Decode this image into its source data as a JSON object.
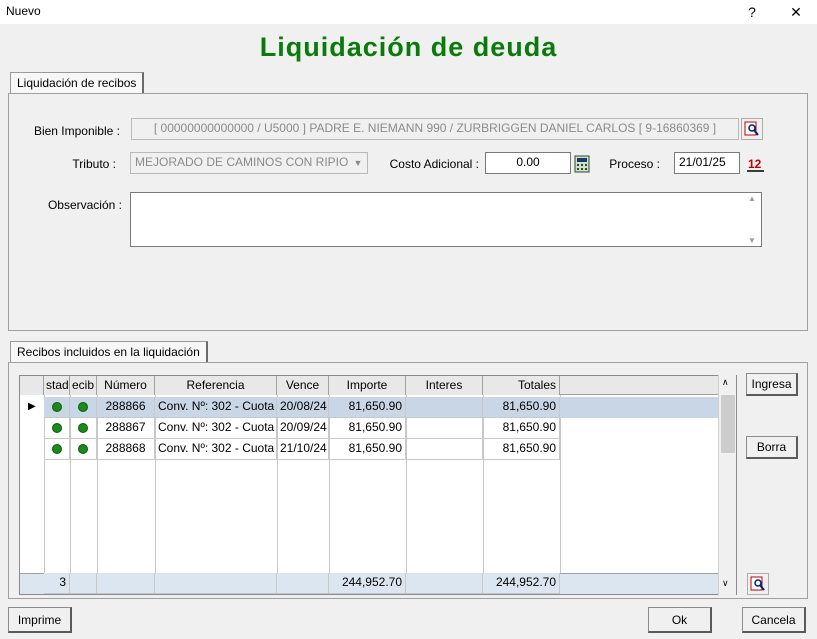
{
  "window": {
    "title": "Nuevo",
    "help_label": "?",
    "close_label": "✕"
  },
  "heading": "Liquidación de deuda",
  "tabs": {
    "top": "Liquidación de recibos",
    "bottom": "Recibos incluidos en la liquidación"
  },
  "form": {
    "bien_label": "Bien Imponible :",
    "bien_value": "[ 00000000000000  /  U5000 ] PADRE E. NIEMANN    990 / ZURBRIGGEN DANIEL CARLOS   [ 9-16860369 ]",
    "tributo_label": "Tributo :",
    "tributo_value": "MEJORADO DE CAMINOS CON RIPIO",
    "costo_label": "Costo Adicional :",
    "costo_value": "0.00",
    "proceso_label": "Proceso :",
    "proceso_value": "21/01/25",
    "obs_label": "Observación :",
    "obs_value": ""
  },
  "grid": {
    "columns": [
      "stad",
      "ecib",
      "Número",
      "Referencia",
      "Vence",
      "Importe",
      "Interes",
      "Totales"
    ],
    "rows": [
      {
        "numero": "288866",
        "referencia": "Conv. Nº: 302 - Cuota",
        "vence": "20/08/24",
        "importe": "81,650.90",
        "interes": "",
        "totales": "81,650.90"
      },
      {
        "numero": "288867",
        "referencia": "Conv. Nº: 302 - Cuota",
        "vence": "20/09/24",
        "importe": "81,650.90",
        "interes": "",
        "totales": "81,650.90"
      },
      {
        "numero": "288868",
        "referencia": "Conv. Nº: 302 - Cuota",
        "vence": "21/10/24",
        "importe": "81,650.90",
        "interes": "",
        "totales": "81,650.90"
      }
    ],
    "footer": {
      "count": "3",
      "importe": "244,952.70",
      "totales": "244,952.70"
    }
  },
  "buttons": {
    "ingresa": "Ingresa",
    "borra": "Borra",
    "imprime": "Imprime",
    "ok": "Ok",
    "cancela": "Cancela"
  },
  "colors": {
    "heading": "#0a7a0a",
    "status_dot": "#1a8a1a",
    "selected_row": "#c8d6e6"
  },
  "icons": {
    "search": "search-icon",
    "calculator": "calculator-icon",
    "calendar": "calendar-icon",
    "row_indicator": "row-pointer-icon"
  }
}
